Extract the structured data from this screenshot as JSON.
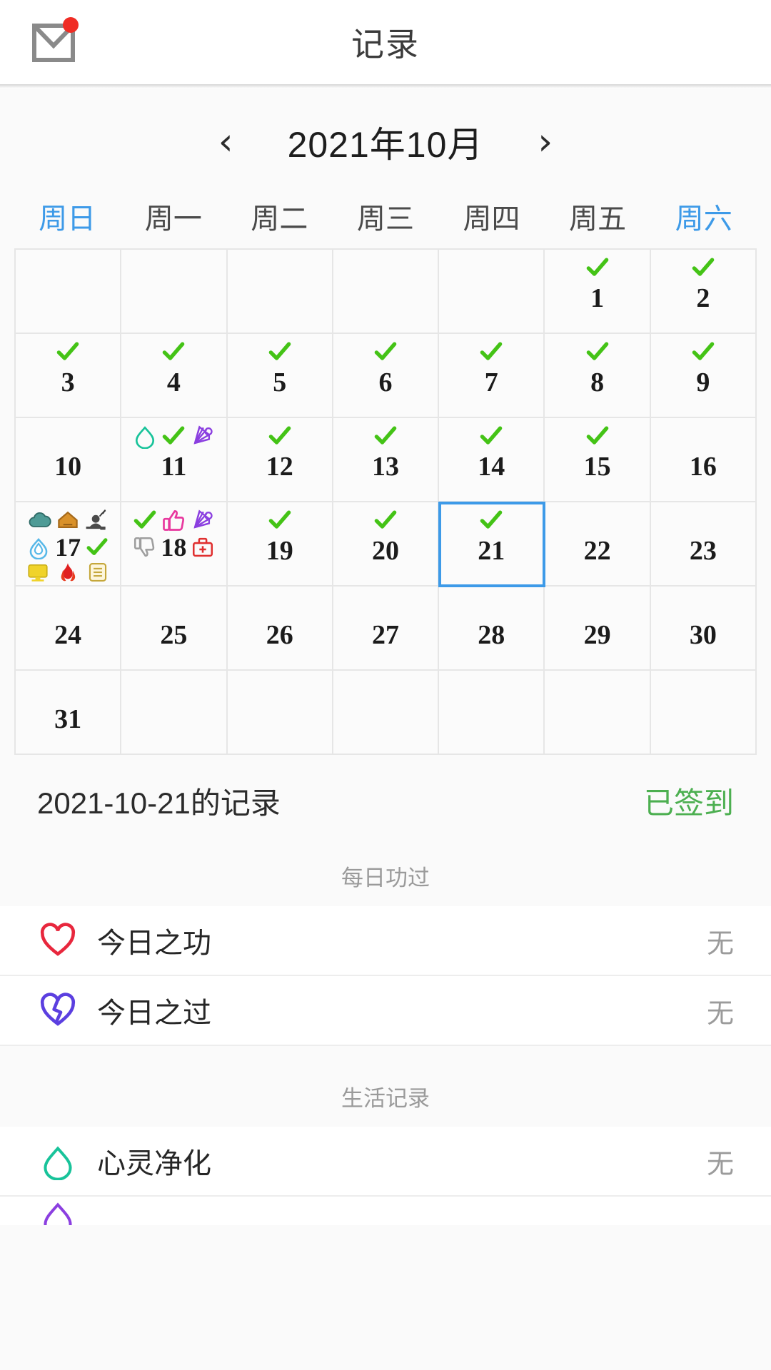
{
  "appbar": {
    "title": "记录",
    "mail_icon": "envelope-icon",
    "badge_color": "#f02c24"
  },
  "month_selector": {
    "prev_label": "‹",
    "next_label": "›",
    "month_label": "2021年10月"
  },
  "calendar": {
    "weekdays": [
      {
        "label": "周日",
        "accent": true
      },
      {
        "label": "周一",
        "accent": false
      },
      {
        "label": "周二",
        "accent": false
      },
      {
        "label": "周三",
        "accent": false
      },
      {
        "label": "周四",
        "accent": false
      },
      {
        "label": "周五",
        "accent": false
      },
      {
        "label": "周六",
        "accent": true
      }
    ],
    "leading_blanks": 5,
    "days": [
      {
        "n": "1",
        "check": true
      },
      {
        "n": "2",
        "check": true
      },
      {
        "n": "3",
        "check": true
      },
      {
        "n": "4",
        "check": true
      },
      {
        "n": "5",
        "check": true
      },
      {
        "n": "6",
        "check": true
      },
      {
        "n": "7",
        "check": true
      },
      {
        "n": "8",
        "check": true
      },
      {
        "n": "9",
        "check": true
      },
      {
        "n": "10",
        "check": false
      },
      {
        "n": "11",
        "check": false,
        "icons_top": [
          "drop-outline-icon",
          "check-icon",
          "shuttlecock-icon"
        ]
      },
      {
        "n": "12",
        "check": true
      },
      {
        "n": "13",
        "check": true
      },
      {
        "n": "14",
        "check": true
      },
      {
        "n": "15",
        "check": true
      },
      {
        "n": "16",
        "check": false
      },
      {
        "n": "17",
        "check": false,
        "icons_top": [
          "cloud-icon",
          "house-icon",
          "desk-study-icon"
        ],
        "icons_mid": [
          "drop-blue-icon",
          "check-icon"
        ],
        "icons_bot": [
          "monitor-icon",
          "flame-icon",
          "document-icon"
        ]
      },
      {
        "n": "18",
        "check": false,
        "icons_top": [
          "check-icon",
          "thumbs-up-icon",
          "shuttlecock-icon"
        ],
        "icons_mid": [
          "thumbs-down-icon",
          "medical-kit-icon"
        ]
      },
      {
        "n": "19",
        "check": true
      },
      {
        "n": "20",
        "check": true
      },
      {
        "n": "21",
        "check": true,
        "selected": true
      },
      {
        "n": "22",
        "check": false
      },
      {
        "n": "23",
        "check": false
      },
      {
        "n": "24",
        "check": false
      },
      {
        "n": "25",
        "check": false
      },
      {
        "n": "26",
        "check": false
      },
      {
        "n": "27",
        "check": false
      },
      {
        "n": "28",
        "check": false
      },
      {
        "n": "29",
        "check": false
      },
      {
        "n": "30",
        "check": false
      },
      {
        "n": "31",
        "check": false
      }
    ],
    "trailing_blanks": 6,
    "selected_day": "21",
    "selected_border_color": "#3d9ae8",
    "check_color": "#44c316"
  },
  "record": {
    "title": "2021-10-21的记录",
    "status": "已签到",
    "status_color": "#4caf50"
  },
  "sections": [
    {
      "label": "每日功过",
      "rows": [
        {
          "icon": "heart-outline-icon",
          "icon_color": "#e8273d",
          "label": "今日之功",
          "value": "无"
        },
        {
          "icon": "broken-heart-icon",
          "icon_color": "#5b3fe0",
          "label": "今日之过",
          "value": "无"
        }
      ]
    },
    {
      "label": "生活记录",
      "rows": [
        {
          "icon": "drop-outline-icon",
          "icon_color": "#18c39a",
          "label": "心灵净化",
          "value": "无"
        }
      ]
    }
  ]
}
